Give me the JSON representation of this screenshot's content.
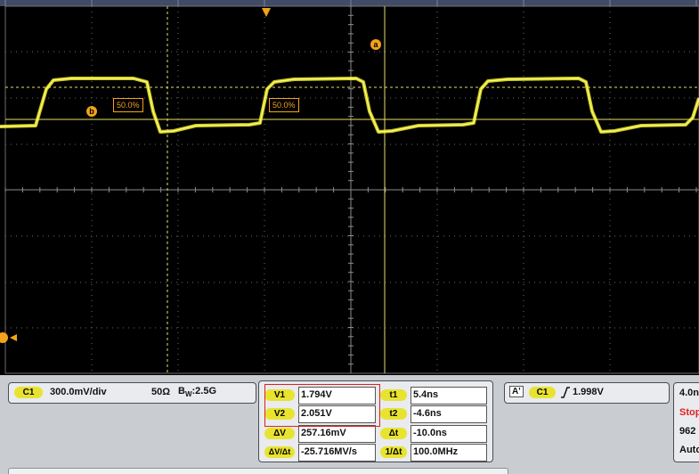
{
  "scope": {
    "cursor_a_label": "a",
    "cursor_b_label": "b",
    "measure_label_left": "50.0%",
    "measure_label_right": "50.0%",
    "trace_color": "#f2f01e",
    "grid_color": "#6b6b6b",
    "cursor_color": "#e6df6a",
    "marker_color": "#f3a21c"
  },
  "channel": {
    "badge": "C1",
    "scale": "300.0mV/div",
    "impedance": "50Ω",
    "bw_prefix": "B",
    "bw_sub": "W",
    "bw_value": ":2.5G"
  },
  "cursors": {
    "v1_label": "V1",
    "v1_value": "1.794V",
    "v2_label": "V2",
    "v2_value": "2.051V",
    "dv_label": "ΔV",
    "dv_value": "257.16mV",
    "dvdt_label": "ΔV/Δt",
    "dvdt_value": "-25.716MV/s",
    "t1_label": "t1",
    "t1_value": "5.4ns",
    "t2_label": "t2",
    "t2_value": "-4.6ns",
    "dt_label": "Δt",
    "dt_value": "-10.0ns",
    "inv_dt_label": "1/Δt",
    "inv_dt_value": "100.0MHz"
  },
  "trigger": {
    "mode_badge": "A'",
    "channel_badge": "C1",
    "slope_icon": "rising-edge",
    "level": "1.998V"
  },
  "acquisition": {
    "timebase": "4.0n",
    "state": "Stop",
    "count": "962",
    "mode": "Auto"
  }
}
